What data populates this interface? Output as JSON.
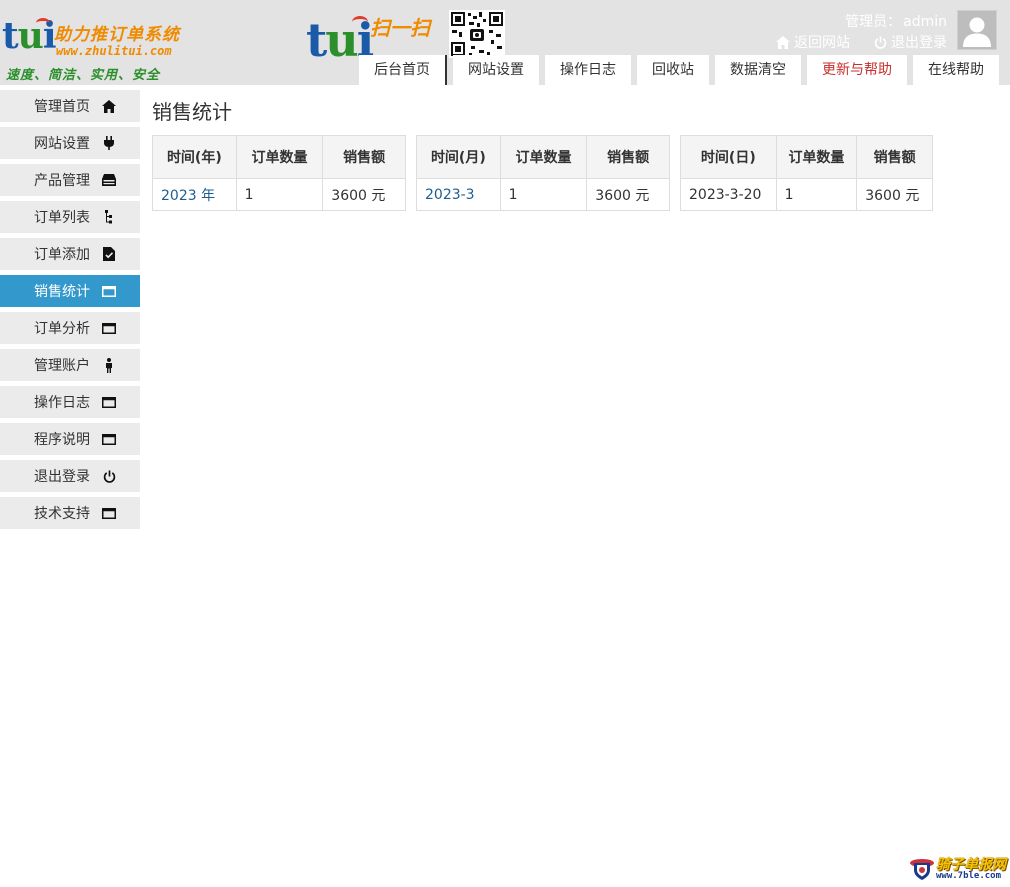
{
  "branding": {
    "logo_text_t": "t",
    "logo_text_u": "u",
    "logo_text_i": "i",
    "system_name": "助力推订单系统",
    "site_url": "www.zhulitui.com",
    "slogan": "速度、简洁、实用、安全",
    "scan_label": "扫一扫"
  },
  "header": {
    "admin_label": "管理员：",
    "admin_name": "admin",
    "back_site": "返回网站",
    "logout": "退出登录"
  },
  "tabs": [
    {
      "label": "后台首页"
    },
    {
      "label": "网站设置"
    },
    {
      "label": "操作日志"
    },
    {
      "label": "回收站"
    },
    {
      "label": "数据清空"
    },
    {
      "label": "更新与帮助"
    },
    {
      "label": "在线帮助"
    }
  ],
  "sidebar": {
    "items": [
      {
        "label": "管理首页",
        "icon": "home-icon"
      },
      {
        "label": "网站设置",
        "icon": "plug-icon"
      },
      {
        "label": "产品管理",
        "icon": "hdd-icon"
      },
      {
        "label": "订单列表",
        "icon": "list-icon"
      },
      {
        "label": "订单添加",
        "icon": "file-check-icon"
      },
      {
        "label": "销售统计",
        "icon": "window-icon",
        "active": true
      },
      {
        "label": "订单分析",
        "icon": "window-icon"
      },
      {
        "label": "管理账户",
        "icon": "user-icon"
      },
      {
        "label": "操作日志",
        "icon": "window-icon"
      },
      {
        "label": "程序说明",
        "icon": "window-icon"
      },
      {
        "label": "退出登录",
        "icon": "power-icon"
      },
      {
        "label": "技术支持",
        "icon": "window-icon"
      }
    ]
  },
  "main": {
    "title": "销售统计",
    "tables": [
      {
        "headers": [
          "时间(年)",
          "订单数量",
          "销售额"
        ],
        "rows": [
          [
            "2023 年",
            "1",
            "3600 元"
          ]
        ]
      },
      {
        "headers": [
          "时间(月)",
          "订单数量",
          "销售额"
        ],
        "rows": [
          [
            "2023-3",
            "1",
            "3600 元"
          ]
        ]
      },
      {
        "headers": [
          "时间(日)",
          "订单数量",
          "销售额"
        ],
        "rows": [
          [
            "2023-3-20",
            "1",
            "3600 元"
          ]
        ]
      }
    ]
  },
  "watermark": {
    "text": "骑子单报网",
    "url": "www.7ble.com"
  },
  "colors": {
    "header_bg": "#e3e3e3",
    "sidebar_item_bg": "#ebebeb",
    "active": "#3399cc",
    "link": "#1f5d91",
    "tab_red": "#c9302c"
  }
}
